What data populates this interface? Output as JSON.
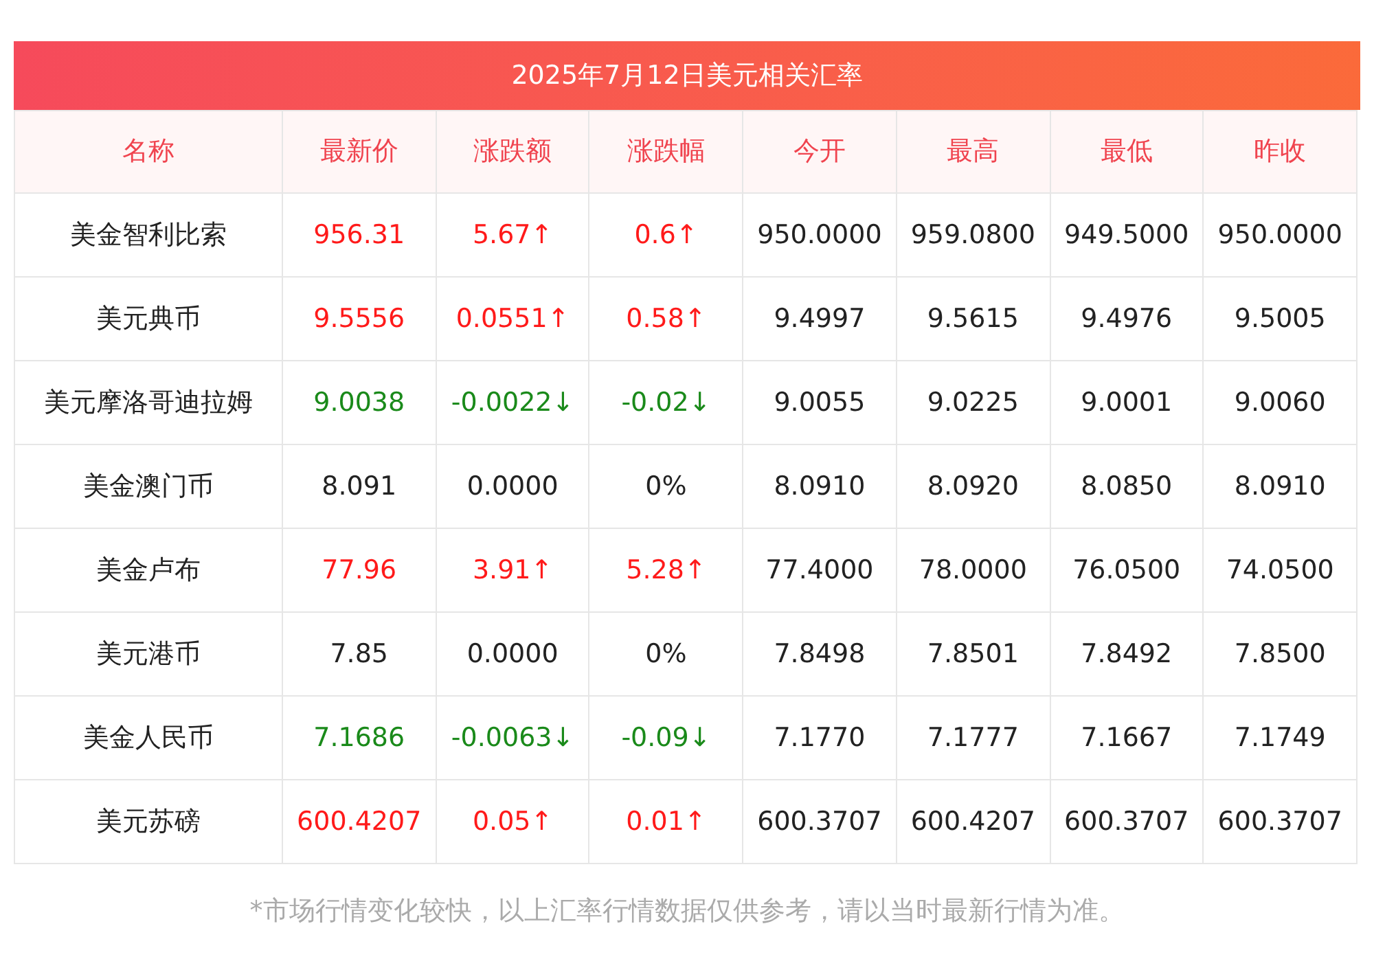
{
  "title": "2025年7月12日美元相关汇率",
  "columns": [
    "名称",
    "最新价",
    "涨跌额",
    "涨跌幅",
    "今开",
    "最高",
    "最低",
    "昨收"
  ],
  "rows": [
    {
      "color": "#ff1a1a",
      "cells": [
        "美金智利比索",
        "956.31",
        "5.67↑",
        "0.6↑",
        "950.0000",
        "959.0800",
        "949.5000",
        "950.0000"
      ]
    },
    {
      "color": "#ff1a1a",
      "cells": [
        "美元典币",
        "9.5556",
        "0.0551↑",
        "0.58↑",
        "9.4997",
        "9.5615",
        "9.4976",
        "9.5005"
      ]
    },
    {
      "color": "#1a8a1a",
      "cells": [
        "美元摩洛哥迪拉姆",
        "9.0038",
        "-0.0022↓",
        "-0.02↓",
        "9.0055",
        "9.0225",
        "9.0001",
        "9.0060"
      ]
    },
    {
      "color": "#222222",
      "cells": [
        "美金澳门币",
        "8.091",
        "0.0000",
        "0%",
        "8.0910",
        "8.0920",
        "8.0850",
        "8.0910"
      ]
    },
    {
      "color": "#ff1a1a",
      "cells": [
        "美金卢布",
        "77.96",
        "3.91↑",
        "5.28↑",
        "77.4000",
        "78.0000",
        "76.0500",
        "74.0500"
      ]
    },
    {
      "color": "#222222",
      "cells": [
        "美元港币",
        "7.85",
        "0.0000",
        "0%",
        "7.8498",
        "7.8501",
        "7.8492",
        "7.8500"
      ]
    },
    {
      "color": "#1a8a1a",
      "cells": [
        "美金人民币",
        "7.1686",
        "-0.0063↓",
        "-0.09↓",
        "7.1770",
        "7.1777",
        "7.1667",
        "7.1749"
      ]
    },
    {
      "color": "#ff1a1a",
      "cells": [
        "美元苏磅",
        "600.4207",
        "0.05↑",
        "0.01↑",
        "600.3707",
        "600.4207",
        "600.3707",
        "600.3707"
      ]
    }
  ],
  "footnote": "*市场行情变化较快，以上汇率行情数据仅供参考，请以当时最新行情为准。"
}
